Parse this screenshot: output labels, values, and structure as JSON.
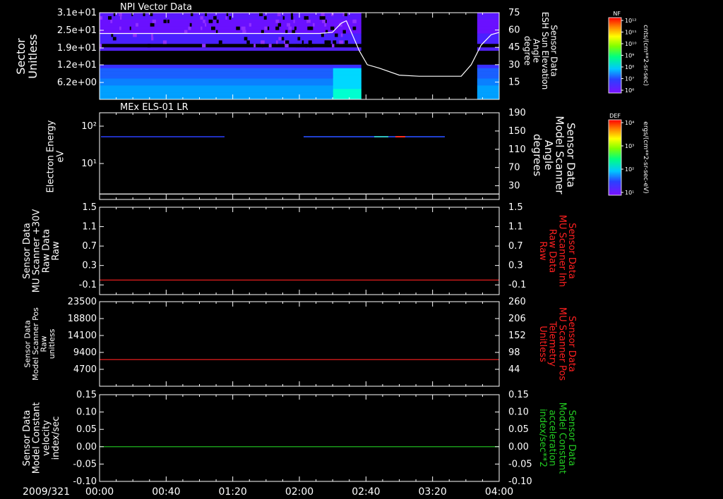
{
  "date_label": "2009/321",
  "time_ticks": [
    "00:00",
    "00:40",
    "01:20",
    "02:00",
    "02:40",
    "03:20",
    "04:00"
  ],
  "colors": {
    "background": "#000000",
    "axes": "#ffffff",
    "red_trace": "#ff2020",
    "green_trace": "#22cc22"
  },
  "colorbars": [
    {
      "panel": "npi",
      "header": "NF",
      "unit": "cnts/(cm**2-sr-sec)",
      "ticks": [
        "10¹²",
        "10¹¹",
        "10¹⁰",
        "10⁹",
        "10⁸",
        "10⁷",
        "10⁶"
      ]
    },
    {
      "panel": "els",
      "header": "DEF",
      "unit": "ergs/(cm**2-sr-sec-eV)",
      "ticks": [
        "10⁴",
        "10³",
        "10²",
        "10¹"
      ]
    }
  ],
  "chart_data": [
    {
      "type": "heatmap",
      "title": "NPI Vector Data",
      "ylabel": "Sector\nUnitless",
      "ylabel_right": "Sensor Data\nESH Sun Elevation\nAngle\ndegree",
      "ytick_labels": [
        "3.1e+01",
        "2.5e+01",
        "1.9e+01",
        "1.2e+01",
        "6.2e+00"
      ],
      "right_ticks": [
        "75",
        "60",
        "45",
        "30",
        "15"
      ],
      "ylim_right": [
        0,
        75
      ],
      "overlay_line": {
        "color": "#ffffff",
        "points": [
          [
            0.0,
            57
          ],
          [
            2.2,
            57
          ],
          [
            2.33,
            58
          ],
          [
            2.42,
            66
          ],
          [
            2.47,
            68
          ],
          [
            2.52,
            58
          ],
          [
            2.6,
            42
          ],
          [
            2.68,
            30
          ],
          [
            2.8,
            27
          ],
          [
            3.0,
            21
          ],
          [
            3.2,
            20
          ],
          [
            3.4,
            20
          ],
          [
            3.62,
            20
          ],
          [
            3.72,
            30
          ],
          [
            3.82,
            47
          ],
          [
            3.92,
            56
          ],
          [
            4.0,
            58
          ]
        ]
      },
      "data_gap_hours": [
        2.62,
        3.78
      ]
    },
    {
      "type": "heatmap",
      "title": "MEx ELS-01 LR",
      "ylabel": "Electron Energy\neV",
      "ylabel_right": "Sensor Data\nModel Scanner\nAngle\ndegrees",
      "ytick_labels": [
        "10²",
        "10¹"
      ],
      "right_ticks": [
        "190",
        "150",
        "110",
        "70",
        "30"
      ],
      "ylim_right": [
        0,
        190
      ],
      "overlay_line": {
        "color": "#ffffff",
        "points": [
          [
            0,
            12
          ],
          [
            4,
            12
          ]
        ]
      }
    },
    {
      "type": "line",
      "title": "",
      "ylabel": "Sensor Data\nMU Scanner +30V\nRaw Data\nRaw",
      "ylabel_right": "Sensor Data\nMU Scanner Inh\nRaw Data\nRaw",
      "ylim": [
        -0.3,
        1.5
      ],
      "yticks": [
        1.5,
        1.1,
        0.7,
        0.3,
        -0.1
      ],
      "ytick_labels": [
        "1.5",
        "1.1",
        "0.7",
        "0.3",
        "-0.1"
      ],
      "right_ticks": [
        "1.5",
        "1.1",
        "0.7",
        "0.3",
        "-0.1"
      ],
      "series": [
        {
          "color": "#ff2020",
          "points": [
            [
              0,
              0.0
            ],
            [
              4,
              0.0
            ]
          ]
        }
      ]
    },
    {
      "type": "line",
      "title": "",
      "ylabel": "Sensor Data\nModel Scanner Pos\nRaw\nunitless",
      "ylabel_right": "Sensor Data\nMU Scanner Pos\nTelemetry\nUnitless",
      "ylim": [
        0,
        23500
      ],
      "yticks": [
        23500,
        18800,
        14100,
        9400,
        4700
      ],
      "ytick_labels": [
        "23500",
        "18800",
        "14100",
        "9400",
        "4700"
      ],
      "right_ticks": [
        "260",
        "206",
        "152",
        "98",
        "44"
      ],
      "series": [
        {
          "color": "#ff2020",
          "points": [
            [
              0,
              7400
            ],
            [
              4,
              7400
            ]
          ]
        }
      ]
    },
    {
      "type": "line",
      "title": "",
      "ylabel": "Sensor Data\nModel Constant\nvelocity\nindex/sec",
      "ylabel_right": "Sensor Data\nModel Constant\nacceleration\nindex/sec**2",
      "ylim": [
        -0.1,
        0.15
      ],
      "yticks": [
        0.15,
        0.1,
        0.05,
        0.0,
        -0.05,
        -0.1
      ],
      "ytick_labels": [
        "0.15",
        "0.10",
        "0.05",
        "0.00",
        "-0.05",
        "-0.10"
      ],
      "right_ticks": [
        "0.15",
        "0.10",
        "0.05",
        "0.00",
        "-0.05",
        "-0.10"
      ],
      "series": [
        {
          "color": "#22cc22",
          "points": [
            [
              0,
              0.0
            ],
            [
              4,
              0.0
            ]
          ]
        }
      ]
    }
  ]
}
